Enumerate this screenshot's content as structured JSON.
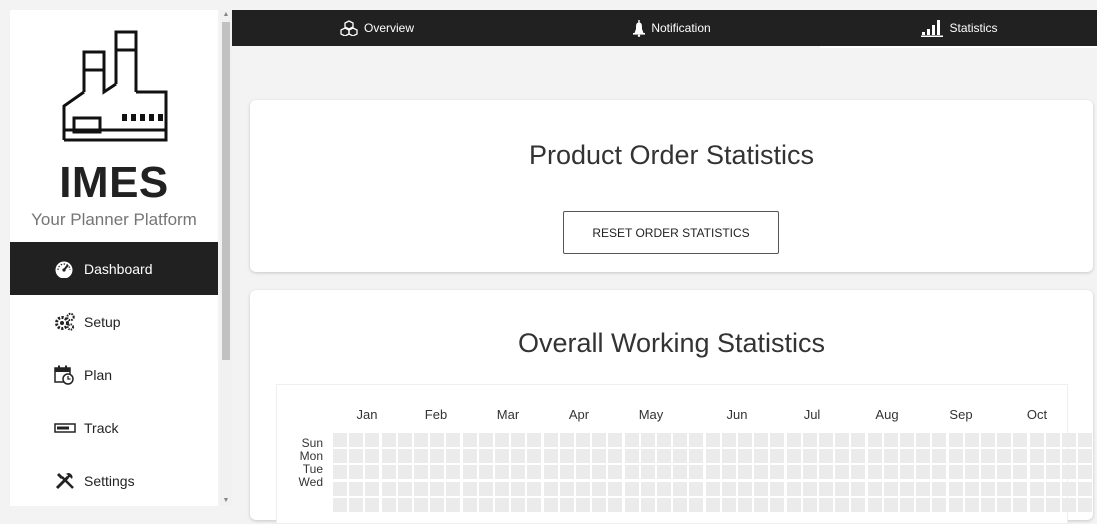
{
  "sidebar": {
    "brand": "IMES",
    "tagline": "Your Planner Platform",
    "items": [
      {
        "label": "Dashboard",
        "icon": "dashboard-gauge-icon",
        "active": true
      },
      {
        "label": "Setup",
        "icon": "gears-icon",
        "active": false
      },
      {
        "label": "Plan",
        "icon": "calendar-clock-icon",
        "active": false
      },
      {
        "label": "Track",
        "icon": "track-bar-icon",
        "active": false
      },
      {
        "label": "Settings",
        "icon": "tools-icon",
        "active": false
      }
    ]
  },
  "topnav": {
    "tabs": [
      {
        "label": "Overview",
        "icon": "overview-cubes-icon",
        "active": false
      },
      {
        "label": "Notification",
        "icon": "bell-icon",
        "active": false
      },
      {
        "label": "Statistics",
        "icon": "bar-chart-icon",
        "active": true
      }
    ]
  },
  "order_card": {
    "title": "Product Order Statistics",
    "reset_label": "RESET ORDER STATISTICS"
  },
  "working_card": {
    "title": "Overall Working Statistics",
    "months": [
      "Jan",
      "Feb",
      "Mar",
      "Apr",
      "May",
      "Jun",
      "Jul",
      "Aug",
      "Sep",
      "Oct"
    ],
    "days": [
      "Sun",
      "Mon",
      "Tue",
      "Wed"
    ]
  },
  "colors": {
    "dark": "#212121",
    "cell_empty": "#ebebeb",
    "background": "#f3f3f3"
  }
}
